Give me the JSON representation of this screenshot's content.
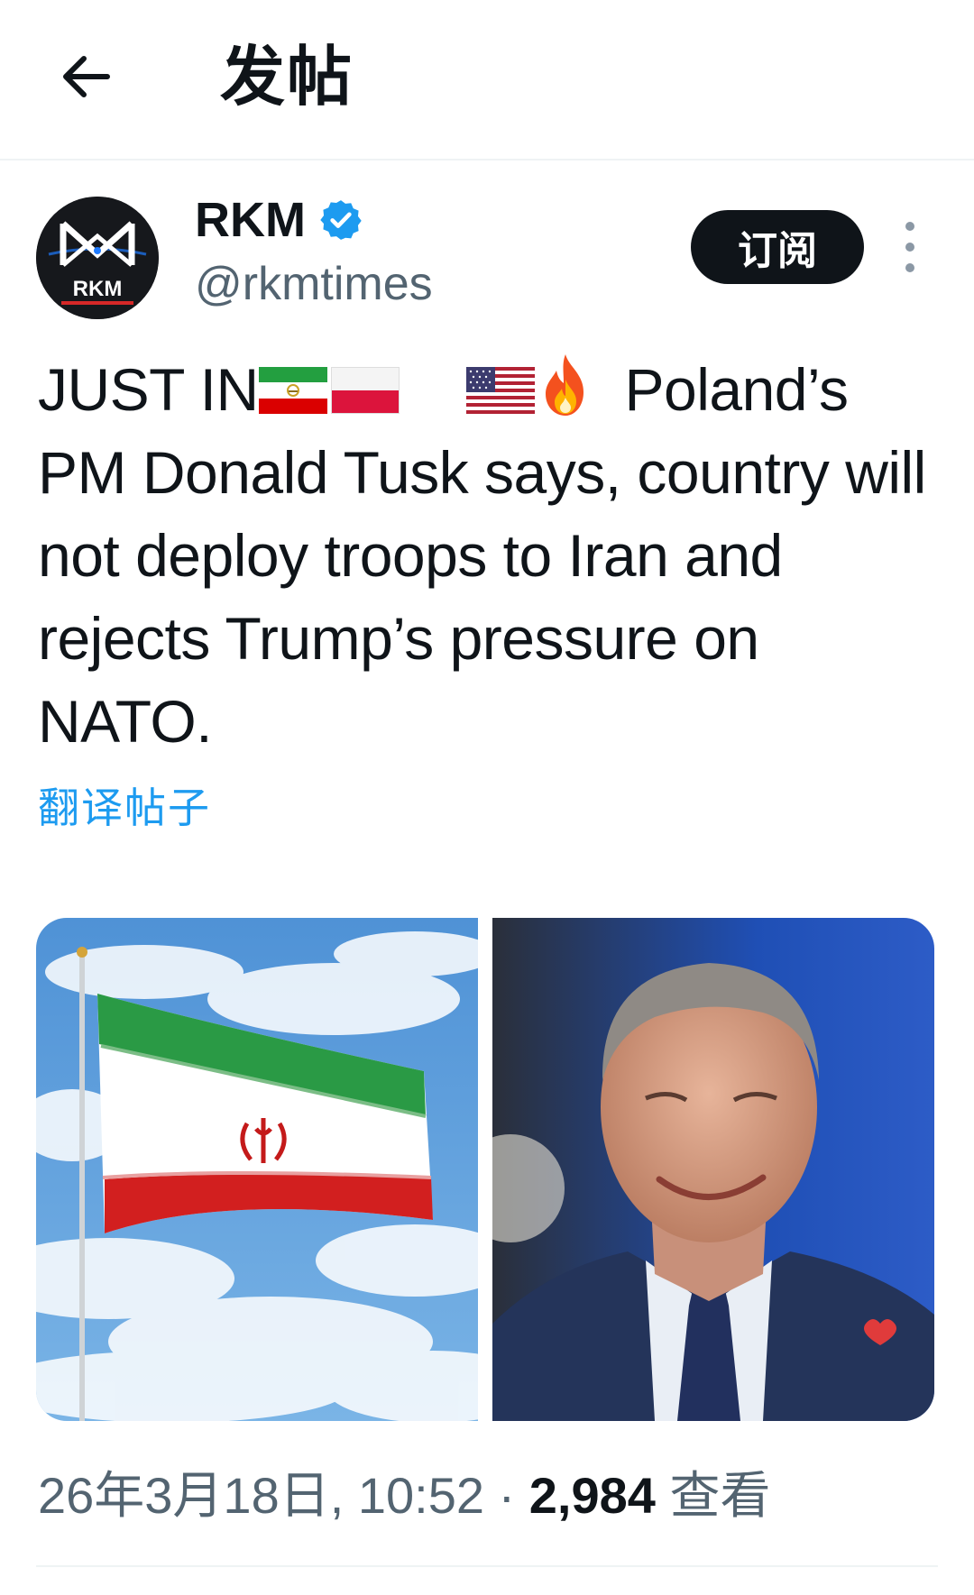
{
  "header": {
    "title": "发帖"
  },
  "author": {
    "name": "RKM",
    "handle": "@rkmtimes",
    "avatar_text": "RKM",
    "subscribe_label": "订阅"
  },
  "tweet": {
    "text_prefix": "JUST IN",
    "text_main": " Poland’s PM Donald Tusk says, country will not deploy  troops to Iran and rejects Trump’s pressure on NATO.",
    "translate_label": "翻译帖子",
    "date": "26年3月18日, 10:52",
    "separator": " · ",
    "views_count": "2,984",
    "views_label": " 查看"
  },
  "colors": {
    "accent": "#1d9bf0",
    "text": "#0f1419",
    "secondary": "#536471"
  },
  "icons": [
    "back-arrow-icon",
    "verified-badge-icon",
    "more-icon",
    "iran-flag-icon",
    "poland-flag-icon",
    "us-flag-icon",
    "fire-icon"
  ]
}
